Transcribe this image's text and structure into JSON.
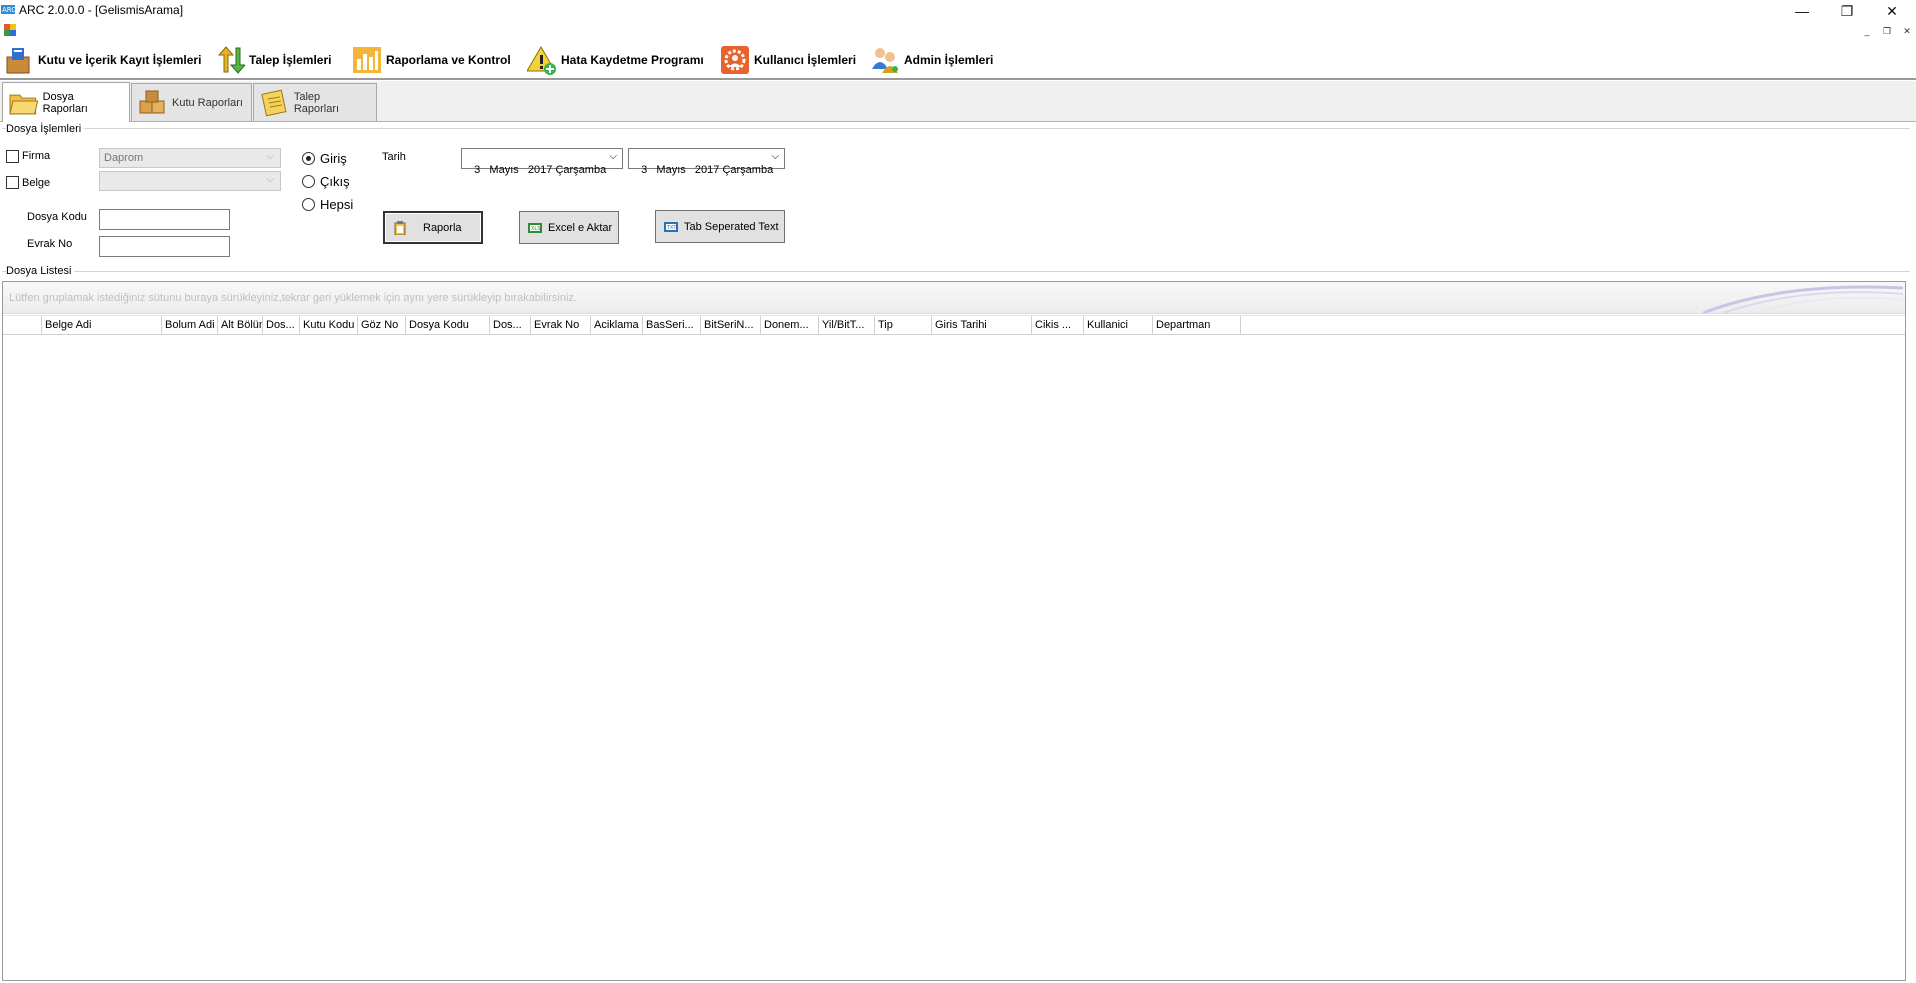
{
  "window": {
    "title": "ARC 2.0.0.0 - [GelismisArama]",
    "minimize": "—",
    "restore": "❐",
    "close": "✕"
  },
  "mdi": {
    "minimize": "_",
    "restore": "❐",
    "close": "✕"
  },
  "menu": [
    {
      "label": "Kutu ve İçerik Kayıt İşlemleri",
      "icon": "box-icon"
    },
    {
      "label": "Talep İşlemleri",
      "icon": "request-arrows-icon"
    },
    {
      "label": "Raporlama ve Kontrol",
      "icon": "report-chart-icon"
    },
    {
      "label": "Hata Kaydetme Programı",
      "icon": "warning-icon"
    },
    {
      "label": "Kullanıcı İşlemleri",
      "icon": "user-gear-icon"
    },
    {
      "label": "Admin İşlemleri",
      "icon": "admin-users-icon"
    }
  ],
  "tabs": [
    {
      "label": "Dosya Raporları",
      "active": true
    },
    {
      "label": "Kutu Raporları",
      "active": false
    },
    {
      "label": "Talep Raporları",
      "active": false
    }
  ],
  "form": {
    "group_title": "Dosya İşlemleri",
    "firma_label": "Firma",
    "firma_value": "Daprom",
    "belge_label": "Belge",
    "belge_value": "",
    "dosya_kodu_label": "Dosya Kodu",
    "evrak_no_label": "Evrak No",
    "radio_giris": "Giriş",
    "radio_cikis": "Çıkış",
    "radio_hepsi": "Hepsi",
    "selected_radio": "Giriş",
    "tarih_label": "Tarih",
    "date_from": "3   Mayıs   2017 Çarşamba",
    "date_to": "3   Mayıs   2017 Çarşamba",
    "btn_raporla": "Raporla",
    "btn_excel": "Excel e Aktar",
    "btn_tab": "Tab Seperated Text"
  },
  "list": {
    "group_title": "Dosya Listesi",
    "group_hint": "Lütfen gruplamak istediğiniz sütunu buraya sürükleyiniz,tekrar geri yüklemek için aynı yere sürükleyip bırakabilirsiniz.",
    "columns": [
      "",
      "Belge Adi",
      "Bolum Adi",
      "Alt Bölüm",
      "Dos...",
      "Kutu Kodu",
      "Göz No",
      "Dosya Kodu",
      "Dos...",
      "Evrak No",
      "Aciklama",
      "BasSeri...",
      "BitSeriN...",
      "Donem...",
      "Yil/BitT...",
      "Tip",
      "Giris Tarihi",
      "Cikis ...",
      "Kullanici",
      "Departman"
    ]
  },
  "colors": {
    "menu_border": "#9a9a9a",
    "tab_bg": "#f0f0f0",
    "button_bg": "#e1e1e1"
  }
}
